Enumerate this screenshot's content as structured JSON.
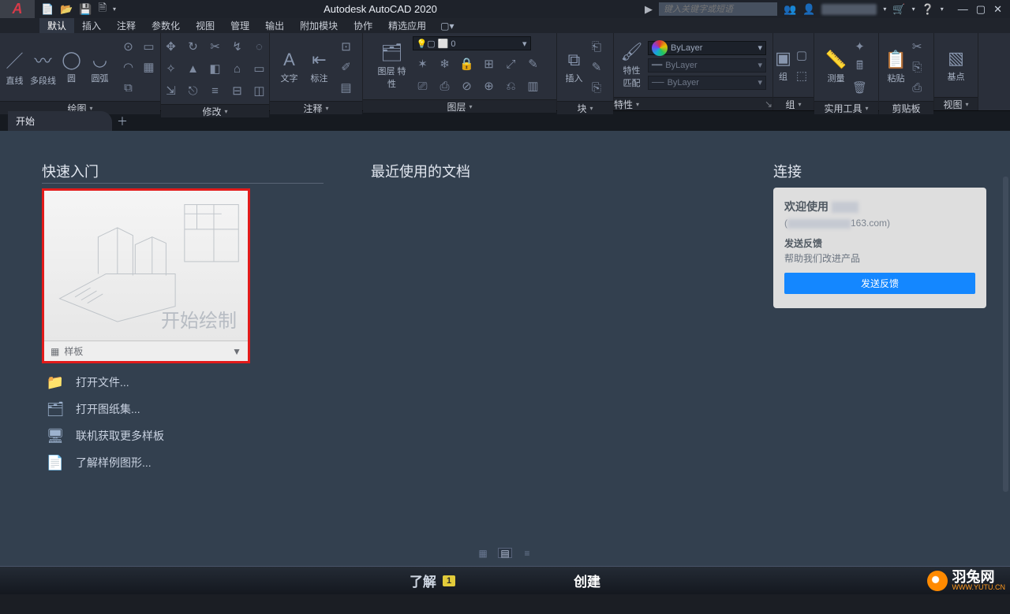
{
  "title": "Autodesk AutoCAD 2020",
  "menu": {
    "tabs": [
      "默认",
      "插入",
      "注释",
      "参数化",
      "视图",
      "管理",
      "输出",
      "附加模块",
      "协作",
      "精选应用"
    ],
    "active": 0
  },
  "search_placeholder": "键入关键字或短语",
  "ribbon_panels": {
    "draw": {
      "label": "绘图",
      "btns": [
        "直线",
        "多段线",
        "圆",
        "圆弧"
      ]
    },
    "modify": {
      "label": "修改"
    },
    "annot": {
      "label": "注释",
      "btns": [
        "文字",
        "标注"
      ]
    },
    "layer": {
      "label": "图层",
      "btn": "图层\n特性"
    },
    "block": {
      "label": "块",
      "btn": "插入"
    },
    "props": {
      "label": "特性",
      "btn": "特性\n匹配",
      "combos": [
        "ByLayer",
        "ByLayer",
        "ByLayer"
      ]
    },
    "group": {
      "label": "组",
      "btn": "组"
    },
    "util": {
      "label": "实用工具",
      "btn": "测量"
    },
    "clip": {
      "label": "剪贴板",
      "btn": "粘贴"
    },
    "view": {
      "label": "视图",
      "btn": "基点"
    }
  },
  "doc_tabs": {
    "start": "开始"
  },
  "start": {
    "col1_title": "快速入门",
    "canvas_label": "开始绘制",
    "template_label": "样板",
    "links": [
      "打开文件...",
      "打开图纸集...",
      "联机获取更多样板",
      "了解样例图形..."
    ],
    "col2_title": "最近使用的文档",
    "col3_title": "连接",
    "connect": {
      "welcome": "欢迎使用",
      "mail_suffix": "163.com)",
      "feedback_h": "发送反馈",
      "feedback_s": "帮助我们改进产品",
      "feedback_btn": "发送反馈"
    },
    "bottom": {
      "learn": "了解",
      "learn_badge": "1",
      "create": "创建"
    }
  },
  "watermark": {
    "name": "羽兔网",
    "url": "WWW.YUTU.CN"
  }
}
